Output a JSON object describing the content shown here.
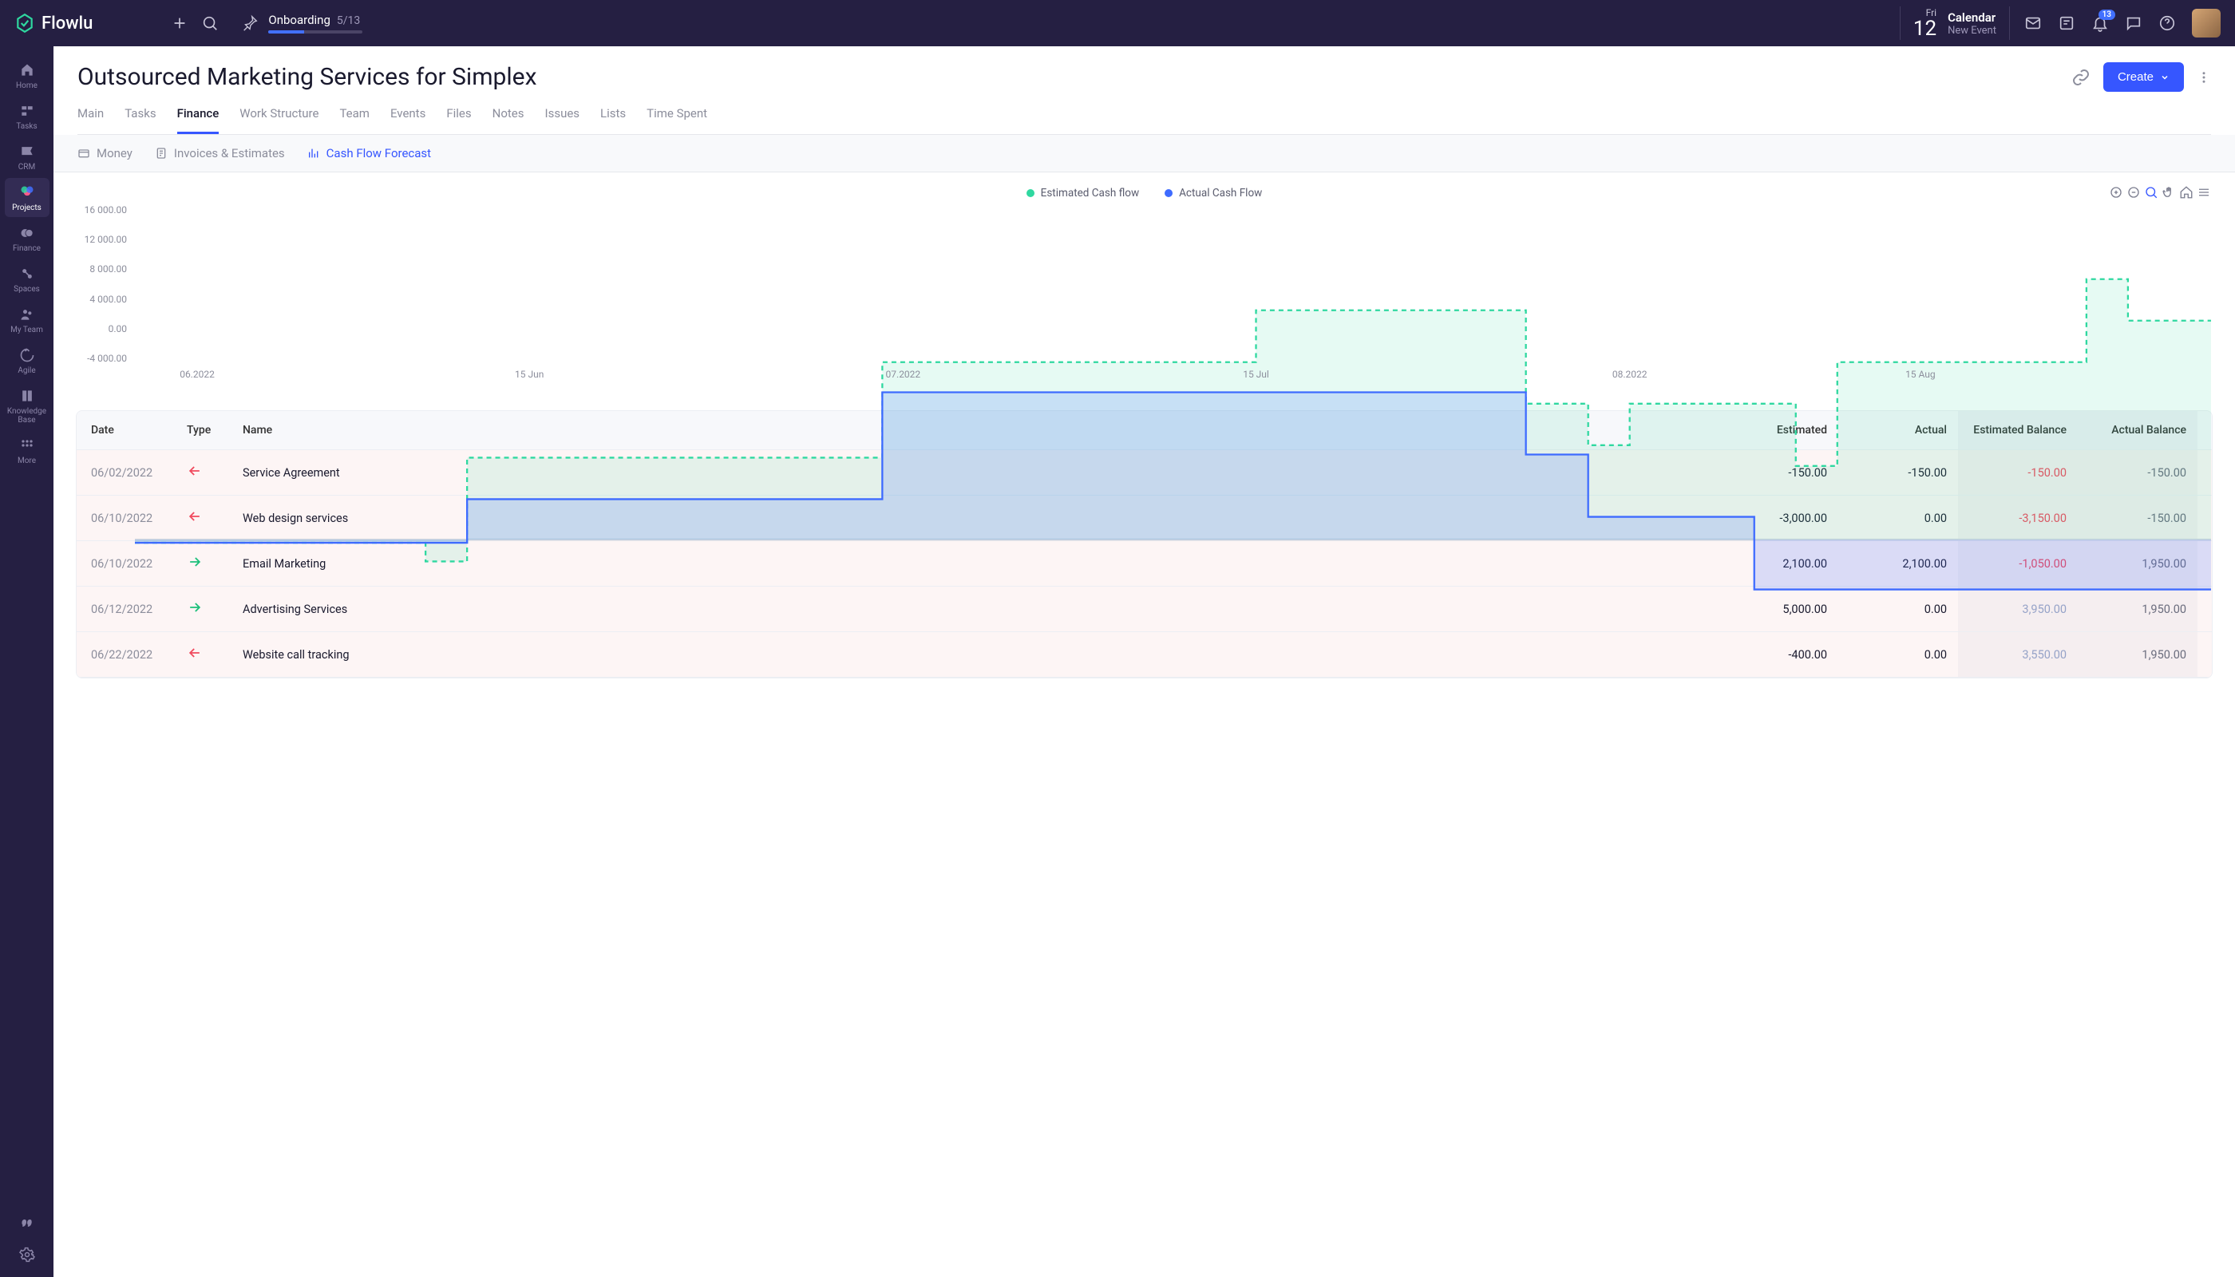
{
  "brand": "Flowlu",
  "onboarding": {
    "label": "Onboarding",
    "progress": "5/13"
  },
  "date": {
    "dow": "Fri",
    "day": "12",
    "title": "Calendar",
    "subtitle": "New Event"
  },
  "notif_count": "13",
  "sidebar": {
    "items": [
      {
        "label": "Home"
      },
      {
        "label": "Tasks"
      },
      {
        "label": "CRM"
      },
      {
        "label": "Projects"
      },
      {
        "label": "Finance"
      },
      {
        "label": "Spaces"
      },
      {
        "label": "My Team"
      },
      {
        "label": "Agile"
      },
      {
        "label": "Knowledge Base"
      },
      {
        "label": "More"
      }
    ]
  },
  "page": {
    "title": "Outsourced Marketing Services for Simplex",
    "create": "Create"
  },
  "tabs": [
    "Main",
    "Tasks",
    "Finance",
    "Work Structure",
    "Team",
    "Events",
    "Files",
    "Notes",
    "Issues",
    "Lists",
    "Time Spent"
  ],
  "active_tab": 2,
  "subtabs": [
    "Money",
    "Invoices & Estimates",
    "Cash Flow Forecast"
  ],
  "active_subtab": 2,
  "legend": {
    "est": "Estimated Cash flow",
    "act": "Actual Cash Flow"
  },
  "colors": {
    "est": "#2fd8a0",
    "act": "#3e6bff"
  },
  "chart_data": {
    "type": "line",
    "title": "",
    "ylabel": "",
    "xlabel": "",
    "ylim": [
      -4000,
      16000
    ],
    "y_ticks": [
      "16 000.00",
      "12 000.00",
      "8 000.00",
      "4 000.00",
      "0.00",
      "-4 000.00"
    ],
    "x_ticks": [
      {
        "label": "06.2022",
        "pos": 3
      },
      {
        "label": "15 Jun",
        "pos": 19
      },
      {
        "label": "07.2022",
        "pos": 37
      },
      {
        "label": "15 Jul",
        "pos": 54
      },
      {
        "label": "08.2022",
        "pos": 72
      },
      {
        "label": "15 Aug",
        "pos": 86
      }
    ],
    "series": [
      {
        "name": "Estimated Cash flow",
        "color": "#2fd8a0",
        "style": "dashed",
        "points": [
          {
            "x": 0,
            "y": -150
          },
          {
            "x": 14,
            "y": -1050
          },
          {
            "x": 16,
            "y": 3950
          },
          {
            "x": 36,
            "y": 8550
          },
          {
            "x": 54,
            "y": 11050
          },
          {
            "x": 67,
            "y": 6550
          },
          {
            "x": 70,
            "y": 4550
          },
          {
            "x": 72,
            "y": 6550
          },
          {
            "x": 80,
            "y": 3550
          },
          {
            "x": 82,
            "y": 8550
          },
          {
            "x": 94,
            "y": 12550
          },
          {
            "x": 96,
            "y": 10550
          },
          {
            "x": 100,
            "y": 10550
          }
        ]
      },
      {
        "name": "Actual Cash Flow",
        "color": "#3e6bff",
        "style": "solid",
        "points": [
          {
            "x": 0,
            "y": -150
          },
          {
            "x": 16,
            "y": 1950
          },
          {
            "x": 36,
            "y": 7100
          },
          {
            "x": 67,
            "y": 4100
          },
          {
            "x": 70,
            "y": 1100
          },
          {
            "x": 78,
            "y": -2400
          },
          {
            "x": 100,
            "y": -2400
          }
        ]
      }
    ]
  },
  "table": {
    "headers": [
      "Date",
      "Type",
      "Name",
      "Estimated",
      "Actual",
      "Estimated Balance",
      "Actual Balance"
    ],
    "rows": [
      {
        "date": "06/02/2022",
        "type": "out",
        "name": "Service Agreement",
        "est": "-150.00",
        "act": "-150.00",
        "ebal": "-150.00",
        "abal": "-150.00",
        "neg": true,
        "ebal_neg": true
      },
      {
        "date": "06/10/2022",
        "type": "out",
        "name": "Web design services",
        "est": "-3,000.00",
        "act": "0.00",
        "ebal": "-3,150.00",
        "abal": "-150.00",
        "neg": true,
        "ebal_neg": true
      },
      {
        "date": "06/10/2022",
        "type": "in",
        "name": "Email Marketing",
        "est": "2,100.00",
        "act": "2,100.00",
        "ebal": "-1,050.00",
        "abal": "1,950.00",
        "neg": true,
        "ebal_neg": true
      },
      {
        "date": "06/12/2022",
        "type": "in",
        "name": "Advertising Services",
        "est": "5,000.00",
        "act": "0.00",
        "ebal": "3,950.00",
        "abal": "1,950.00",
        "neg": true,
        "ebal_neg": false
      },
      {
        "date": "06/22/2022",
        "type": "out",
        "name": "Website call tracking",
        "est": "-400.00",
        "act": "0.00",
        "ebal": "3,550.00",
        "abal": "1,950.00",
        "neg": true,
        "ebal_neg": false
      }
    ]
  }
}
